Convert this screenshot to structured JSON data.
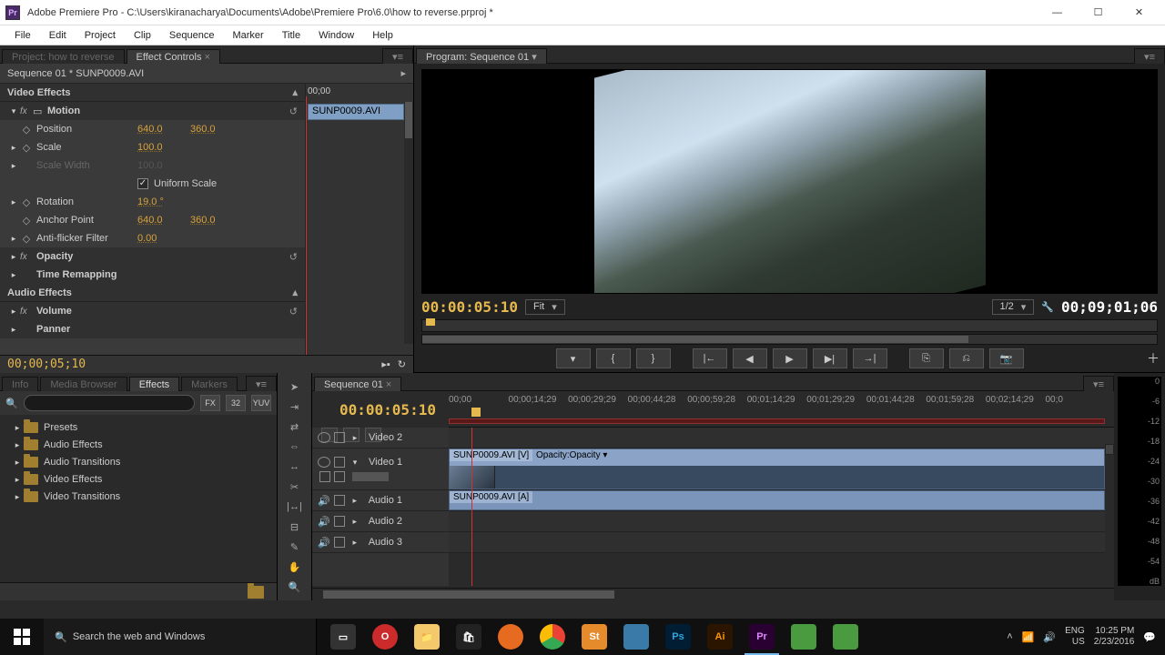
{
  "window": {
    "title": "Adobe Premiere Pro - C:\\Users\\kiranacharya\\Documents\\Adobe\\Premiere Pro\\6.0\\how to reverse.prproj *"
  },
  "menu": [
    "File",
    "Edit",
    "Project",
    "Clip",
    "Sequence",
    "Marker",
    "Title",
    "Window",
    "Help"
  ],
  "upper_tabs": {
    "project": "Project: how to reverse",
    "effect_controls": "Effect Controls"
  },
  "ec": {
    "breadcrumb": "Sequence 01 * SUNP0009.AVI",
    "clip_name": "SUNP0009.AVI",
    "time_label": "00;00",
    "video_effects": "Video Effects",
    "motion": "Motion",
    "position_label": "Position",
    "position_x": "640.0",
    "position_y": "360.0",
    "scale_label": "Scale",
    "scale_val": "100.0",
    "scalew_label": "Scale Width",
    "scalew_val": "100.0",
    "uniform": "Uniform Scale",
    "rotation_label": "Rotation",
    "rotation_val": "19.0 °",
    "anchor_label": "Anchor Point",
    "anchor_x": "640.0",
    "anchor_y": "360.0",
    "antiflicker_label": "Anti-flicker Filter",
    "antiflicker_val": "0.00",
    "opacity": "Opacity",
    "timeremap": "Time Remapping",
    "audio_effects": "Audio Effects",
    "volume": "Volume",
    "panner": "Panner",
    "footer_tc": "00;00;05;10"
  },
  "program": {
    "tab": "Program: Sequence 01",
    "tc_left": "00:00:05:10",
    "fit": "Fit",
    "scale": "1/2",
    "tc_right": "00;09;01;06"
  },
  "lower_tabs": [
    "Info",
    "Media Browser",
    "Effects",
    "Markers"
  ],
  "effects": {
    "search_placeholder": "",
    "icon_labels": [
      "FX",
      "32",
      "YUV"
    ],
    "tree": [
      "Presets",
      "Audio Effects",
      "Audio Transitions",
      "Video Effects",
      "Video Transitions"
    ]
  },
  "timeline": {
    "tab": "Sequence 01",
    "tc": "00:00:05:10",
    "ruler": [
      "00;00",
      "00;00;14;29",
      "00;00;29;29",
      "00;00;44;28",
      "00;00;59;28",
      "00;01;14;29",
      "00;01;29;29",
      "00;01;44;28",
      "00;01;59;28",
      "00;02;14;29",
      "00;0"
    ],
    "tracks": {
      "v2": "Video 2",
      "v1": "Video 1",
      "a1": "Audio 1",
      "a2": "Audio 2",
      "a3": "Audio 3"
    },
    "clip_v1": "SUNP0009.AVI [V]",
    "clip_v1_op": "Opacity:Opacity ▾",
    "clip_a1": "SUNP0009.AVI [A]"
  },
  "meter_scale": [
    "0",
    "-6",
    "-12",
    "-18",
    "-24",
    "-30",
    "-36",
    "-42",
    "-48",
    "-54",
    "dB"
  ],
  "taskbar": {
    "search": "Search the web and Windows",
    "lang": "ENG",
    "region": "US",
    "time": "10:25 PM",
    "date": "2/23/2016"
  }
}
